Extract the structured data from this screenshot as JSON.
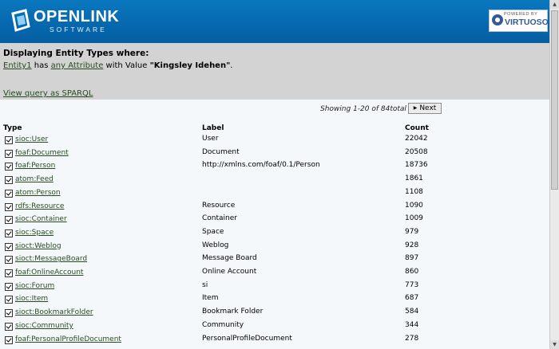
{
  "header": {
    "logo_title": "OPENLINK",
    "logo_subtitle": "SOFTWARE",
    "badge_top": "POWERED BY",
    "badge_name": "VIRTUOSO",
    "color_bg": "#0667ad"
  },
  "description": {
    "heading": "Displaying Entity Types where:",
    "entity_link": "Entity1",
    "has": "has",
    "attribute_link": "any Attribute",
    "with_value": "with Value",
    "value": "\"Kingsley Idehen\"",
    "period": ".",
    "sparql_link": "View query as SPARQL"
  },
  "pagination": {
    "showing": "Showing 1-20 of 84total",
    "next_label": "Next"
  },
  "table": {
    "headers": {
      "type": "Type",
      "label": "Label",
      "count": "Count"
    },
    "rows": [
      {
        "type": "sioc:User",
        "label": "User",
        "count": "22042"
      },
      {
        "type": "foaf:Document",
        "label": "Document",
        "count": "20508"
      },
      {
        "type": "foaf:Person",
        "label": "http://xmlns.com/foaf/0.1/Person",
        "count": "18736"
      },
      {
        "type": "atom:Feed",
        "label": "",
        "count": "1861"
      },
      {
        "type": "atom:Person",
        "label": "",
        "count": "1108"
      },
      {
        "type": "rdfs:Resource",
        "label": "Resource",
        "count": "1090"
      },
      {
        "type": "sioc:Container",
        "label": "Container",
        "count": "1009"
      },
      {
        "type": "sioc:Space",
        "label": "Space",
        "count": "979"
      },
      {
        "type": "sioct:Weblog",
        "label": "Weblog",
        "count": "928"
      },
      {
        "type": "sioct:MessageBoard",
        "label": "Message Board",
        "count": "897"
      },
      {
        "type": "foaf:OnlineAccount",
        "label": "Online Account",
        "count": "860"
      },
      {
        "type": "sioc:Forum",
        "label": "si",
        "count": "773"
      },
      {
        "type": "sioc:Item",
        "label": "Item",
        "count": "687"
      },
      {
        "type": "sioct:BookmarkFolder",
        "label": "Bookmark Folder",
        "count": "584"
      },
      {
        "type": "sioc:Community",
        "label": "Community",
        "count": "344"
      },
      {
        "type": "foaf:PersonalProfileDocument",
        "label": "PersonalProfileDocument",
        "count": "278"
      }
    ]
  }
}
